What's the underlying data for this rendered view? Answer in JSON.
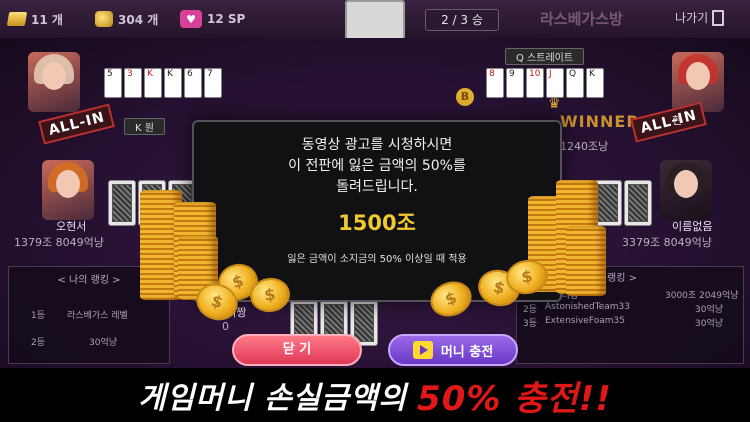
{
  "topbar": {
    "gold_count": "11 개",
    "coin_count": "304 개",
    "sp_count": "12 SP",
    "round": "2 / 3 승",
    "room_title": "라스베가스방",
    "exit_label": "나가기"
  },
  "players": {
    "top_left": {
      "cards": [
        "5",
        "3",
        "K",
        "K",
        "6",
        "7"
      ],
      "hand_label": "K 원",
      "status": "ALL-IN"
    },
    "top_right": {
      "hand_label": "Q 스트레이트",
      "cards": [
        "8",
        "9",
        "10",
        "J",
        "Q",
        "K"
      ],
      "badge": "B",
      "banner_text": "WINNER",
      "status": "ALL-IN",
      "money_fragment": "1240조낭",
      "name_fragment": "현"
    },
    "mid_left": {
      "name": "오현서",
      "money": "1379조 8049억냥"
    },
    "mid_right": {
      "name": "이름없음",
      "money": "3379조 8049억냥"
    },
    "bottom_center": {
      "name": "땅나니짱",
      "money_fragment": "0"
    }
  },
  "my_ranking": {
    "title": "< 나의 랭킹 >",
    "rows": [
      {
        "rank": "1등",
        "name": "라스베가스 레벨",
        "value": ""
      },
      {
        "rank": "2등",
        "name": "",
        "value": "30억냥"
      }
    ]
  },
  "room_ranking": {
    "title": "랭킹 >",
    "rows": [
      {
        "rank": "",
        "name": "땅나니짱",
        "value": "3000조 2049억냥"
      },
      {
        "rank": "2등",
        "name": "AstonishedTeam33",
        "value": "30억냥"
      },
      {
        "rank": "3등",
        "name": "ExtensiveFoam35",
        "value": "30억냥"
      }
    ]
  },
  "dialog": {
    "line1": "동영상 광고를 시청하시면",
    "line2": "이 전판에 잃은 금액의 50%를",
    "line3": "돌려드립니다.",
    "amount": "1500조",
    "note": "잃은 금액이 소지금의 50% 이상일 때 적용",
    "close_label": "닫 기",
    "charge_label": "머니 충전"
  },
  "banner": {
    "white_text": "게임머니 손실금액의",
    "red_text": "50% 충전!!"
  },
  "colors": {
    "accent_gold": "#f0c830",
    "close_pink": "#e03858",
    "charge_purple": "#6a38c8",
    "banner_red": "#e01818"
  }
}
